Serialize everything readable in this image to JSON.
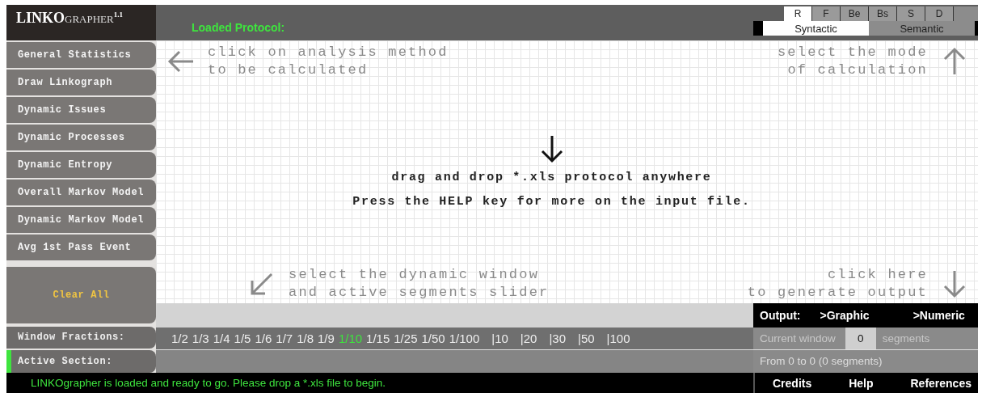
{
  "logo": {
    "lead": "LINKO",
    "rest": "GRAPHER",
    "version": "1.1"
  },
  "loaded_protocol": "Loaded Protocol:",
  "link_tabs": [
    {
      "label": "R",
      "selected": true
    },
    {
      "label": "F",
      "selected": false
    },
    {
      "label": "Be",
      "selected": false
    },
    {
      "label": "Bs",
      "selected": false
    },
    {
      "label": "S",
      "selected": false
    },
    {
      "label": "D",
      "selected": false
    }
  ],
  "mode_tabs": [
    {
      "label": "Syntactic",
      "selected": true
    },
    {
      "label": "Semantic",
      "selected": false
    }
  ],
  "sidebar": {
    "items": [
      {
        "label": "General Statistics"
      },
      {
        "label": "Draw Linkograph"
      },
      {
        "label": "Dynamic Issues"
      },
      {
        "label": "Dynamic Processes"
      },
      {
        "label": "Dynamic Entropy"
      },
      {
        "label": "Overall Markov Model"
      },
      {
        "label": "Dynamic Markov Model"
      },
      {
        "label": "Avg 1st Pass Event"
      }
    ],
    "clear_button": "Clear All"
  },
  "hints": [
    {
      "kind": "left",
      "lines": [
        "click on analysis method",
        "to be calculated"
      ]
    },
    {
      "kind": "up",
      "lines": [
        "select the mode",
        "of calculation"
      ]
    },
    {
      "kind": "down-left",
      "lines": [
        "select the dynamic window",
        "and active segments slider"
      ]
    },
    {
      "kind": "down",
      "lines": [
        "click here",
        "to generate output"
      ]
    }
  ],
  "drop_message": [
    "drag and drop *.xls protocol anywhere",
    "Press the HELP key for more on the input file."
  ],
  "output": {
    "label": "Output:",
    "options": [
      ">Graphic",
      ">Numeric"
    ]
  },
  "window_fractions": {
    "label": "Window Fractions:",
    "items": [
      {
        "label": "1/2",
        "selected": false
      },
      {
        "label": "1/3",
        "selected": false
      },
      {
        "label": "1/4",
        "selected": false
      },
      {
        "label": "1/5",
        "selected": false
      },
      {
        "label": "1/6",
        "selected": false
      },
      {
        "label": "1/7",
        "selected": false
      },
      {
        "label": "1/8",
        "selected": false
      },
      {
        "label": "1/9",
        "selected": false
      },
      {
        "label": "1/10",
        "selected": true
      },
      {
        "label": "1/15",
        "selected": false
      },
      {
        "label": "1/25",
        "selected": false
      },
      {
        "label": "1/50",
        "selected": false
      },
      {
        "label": "1/100",
        "selected": false
      },
      {
        "label": "|10",
        "selected": false
      },
      {
        "label": "|20",
        "selected": false
      },
      {
        "label": "|30",
        "selected": false
      },
      {
        "label": "|50",
        "selected": false
      },
      {
        "label": "|100",
        "selected": false
      }
    ]
  },
  "current_window": {
    "label": "Current window",
    "value": "0",
    "unit": "segments"
  },
  "active_section": {
    "label": "Active Section:",
    "active": true,
    "range": "From 0 to 0 (0 segments)"
  },
  "status_bar": {
    "message": "LINKOgrapher is loaded and ready to go. Please drop a *.xls file to begin.",
    "links": [
      "Credits",
      "Help",
      "References"
    ]
  }
}
